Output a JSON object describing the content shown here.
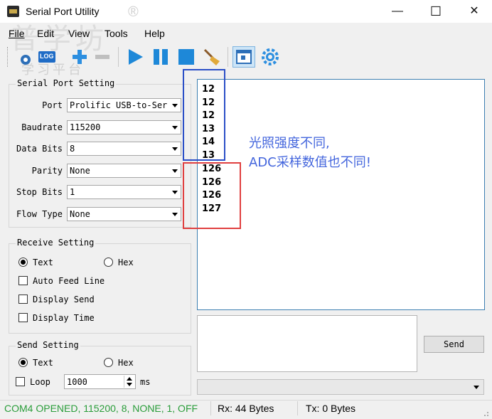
{
  "window": {
    "title": "Serial Port Utility",
    "registered_mark": "®",
    "minimize": "—",
    "maximize": "☐",
    "close": "✕"
  },
  "menu": [
    "File",
    "Edit",
    "View",
    "Tools",
    "Help"
  ],
  "toolbar": {
    "icons": [
      "open-icon",
      "log-icon",
      "zoom-in-icon",
      "zoom-out-icon",
      "play-icon",
      "pause-icon",
      "stop-icon",
      "clear-broom-icon",
      "window-icon",
      "settings-gear-icon"
    ],
    "log_label": "LOG",
    "accent": "#1e88d8"
  },
  "watermark": {
    "line1": "普学坊",
    "line2": "学习平台"
  },
  "serial_port_setting": {
    "title": "Serial Port Setting",
    "port_label": "Port",
    "port_value": "Prolific USB-to-Ser:",
    "baudrate_label": "Baudrate",
    "baudrate_value": "115200",
    "databits_label": "Data Bits",
    "databits_value": "8",
    "parity_label": "Parity",
    "parity_value": "None",
    "stopbits_label": "Stop Bits",
    "stopbits_value": "1",
    "flowtype_label": "Flow Type",
    "flowtype_value": "None"
  },
  "receive_setting": {
    "title": "Receive Setting",
    "text_label": "Text",
    "hex_label": "Hex",
    "mode_selected": "Text",
    "auto_feed_line": "Auto Feed Line",
    "display_send": "Display Send",
    "display_time": "Display Time"
  },
  "send_setting": {
    "title": "Send Setting",
    "text_label": "Text",
    "hex_label": "Hex",
    "mode_selected": "Text",
    "loop_label": "Loop",
    "loop_value": "1000",
    "unit": "ms"
  },
  "receive_data": [
    "12",
    "12",
    "12",
    "13",
    "14",
    "13",
    "126",
    "126",
    "126",
    "127"
  ],
  "annotation": {
    "line1": "光照强度不同,",
    "line2": "ADC采样数值也不同!",
    "color": "#4466dd",
    "box_blue": "#2b4fc7",
    "box_red": "#e04040"
  },
  "send_button": "Send",
  "status": {
    "connection": "COM4 OPENED, 115200, 8, NONE, 1, OFF",
    "connection_color": "#2a9d3a",
    "rx": "Rx: 44 Bytes",
    "tx": "Tx: 0 Bytes"
  }
}
